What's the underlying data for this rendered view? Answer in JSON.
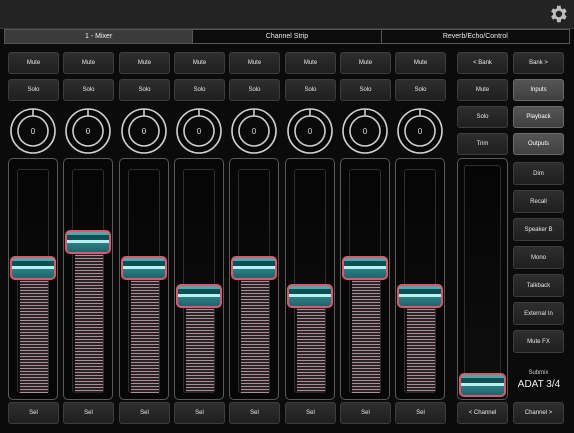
{
  "tabs": [
    {
      "label": "1 - Mixer",
      "active": true
    },
    {
      "label": "Channel Strip",
      "active": false
    },
    {
      "label": "Reverb/Echo/Control",
      "active": false
    }
  ],
  "channels": [
    {
      "mute": "Mute",
      "solo": "Solo",
      "knob": "0",
      "sel": "Sel",
      "level": 0.56
    },
    {
      "mute": "Mute",
      "solo": "Solo",
      "knob": "0",
      "sel": "Sel",
      "level": 0.69
    },
    {
      "mute": "Mute",
      "solo": "Solo",
      "knob": "0",
      "sel": "Sel",
      "level": 0.56
    },
    {
      "mute": "Mute",
      "solo": "Solo",
      "knob": "0",
      "sel": "Sel",
      "level": 0.42
    },
    {
      "mute": "Mute",
      "solo": "Solo",
      "knob": "0",
      "sel": "Sel",
      "level": 0.56
    },
    {
      "mute": "Mute",
      "solo": "Solo",
      "knob": "0",
      "sel": "Sel",
      "level": 0.42
    },
    {
      "mute": "Mute",
      "solo": "Solo",
      "knob": "0",
      "sel": "Sel",
      "level": 0.56
    },
    {
      "mute": "Mute",
      "solo": "Solo",
      "knob": "0",
      "sel": "Sel",
      "level": 0.42
    }
  ],
  "right": {
    "bank_prev": "< Bank",
    "bank_next": "Bank >",
    "mute": "Mute",
    "inputs": "Inputs",
    "solo": "Solo",
    "playback": "Playback",
    "trim": "Trim",
    "outputs": "Outputs",
    "dim": "Dim",
    "recall": "Recall",
    "speaker_b": "Speaker B",
    "mono": "Mono",
    "talkback": "Talkback",
    "external_in": "External In",
    "mute_fx": "Mute FX",
    "submix_label": "Submix",
    "submix_value": "ADAT 3/4",
    "channel_prev": "< Channel",
    "channel_next": "Channel >"
  },
  "master": {
    "level": 0.0
  },
  "colors": {
    "fader_cap_border": "#d95a6f",
    "fader_cap_fill": "#1b5f66",
    "meter": "#ab8f94"
  }
}
